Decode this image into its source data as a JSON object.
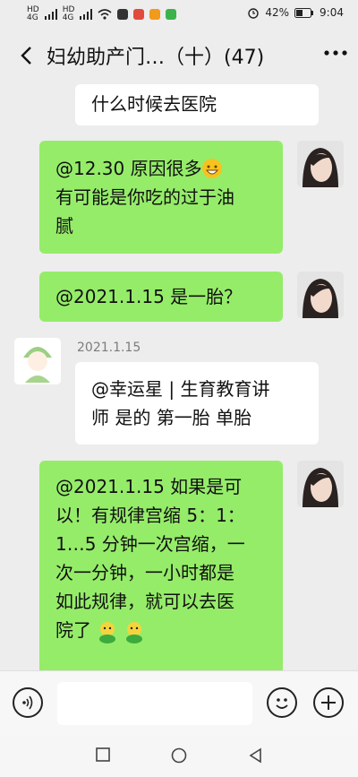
{
  "status_bar": {
    "left_labels": [
      "HD",
      "4G",
      "HD",
      "4G"
    ],
    "battery": "42%",
    "time": "9:04",
    "icons": [
      "signal-icon",
      "wifi-icon",
      "notification-icons",
      "alarm-icon",
      "battery-icon"
    ]
  },
  "header": {
    "title": "妇幼助产门…（十）(47)",
    "back_icon": "back-arrow-icon",
    "more_icon": "more-icon"
  },
  "messages": [
    {
      "text_lines": [
        "什么时候去医院"
      ]
    },
    {
      "text_lines": [
        "@12.30  原因很多",
        "有可能是你吃的过于油",
        "腻"
      ],
      "emoji": "grinning-emoji"
    },
    {
      "text_lines": [
        "@2021.1.15  是一胎？"
      ]
    },
    {
      "sender": "2021.1.15",
      "text_lines": [
        "@幸运星 | 生育教育讲",
        "师  是的  第一胎  单胎"
      ]
    },
    {
      "text_lines": [
        "@2021.1.15  如果是可",
        "以！有规律宫缩 5：1：",
        "1…5 分钟一次宫缩，一",
        "次一分钟，一小时都是",
        "如此规律，就可以去医",
        "院了"
      ],
      "emoji": "cartoon-emoji"
    }
  ],
  "input_bar": {
    "placeholder": "",
    "voice_icon": "voice-icon",
    "emoji_icon": "emoji-icon",
    "plus_icon": "plus-icon"
  },
  "colors": {
    "outgoing": "#95ec69",
    "incoming": "#ffffff",
    "background": "#ededed"
  }
}
